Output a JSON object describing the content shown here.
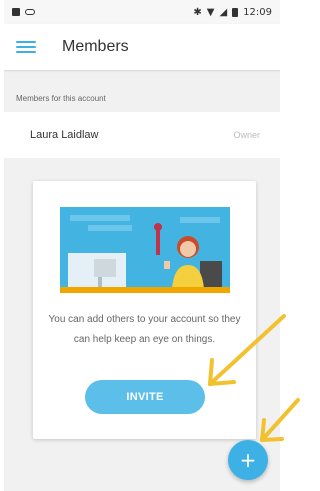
{
  "status_bar": {
    "time": "12:09"
  },
  "app_bar": {
    "title": "Members",
    "menu_icon": "hamburger-menu-icon"
  },
  "members": {
    "section_label": "Members for this account",
    "rows": [
      {
        "name": "Laura Laidlaw",
        "role": "Owner"
      }
    ]
  },
  "invite_card": {
    "text": "You can add others to your account so they can help keep an eye on things.",
    "button_label": "INVITE",
    "illustration": "woman-at-desk-illustration"
  },
  "fab": {
    "label": "+",
    "icon": "plus-icon"
  },
  "annotations": {
    "arrow_color": "#f2c12e"
  },
  "colors": {
    "accent": "#3db0e6",
    "button": "#5cbfe9"
  }
}
